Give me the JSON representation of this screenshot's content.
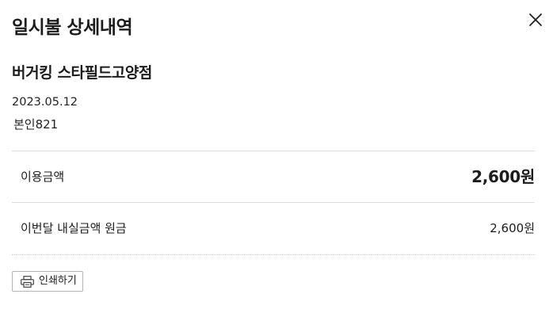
{
  "dialog": {
    "title": "일시불 상세내역",
    "close_icon": "close-icon"
  },
  "transaction": {
    "merchant": "버거킹 스타필드고양점",
    "date": "2023.05.12",
    "card_holder": "본인821"
  },
  "details": {
    "amount_label": "이용금액",
    "amount_value": "2,600원",
    "principal_label": "이번달 내실금액 원금",
    "principal_value": "2,600원"
  },
  "actions": {
    "print_label": "인쇄하기",
    "print_icon": "printer-icon"
  }
}
